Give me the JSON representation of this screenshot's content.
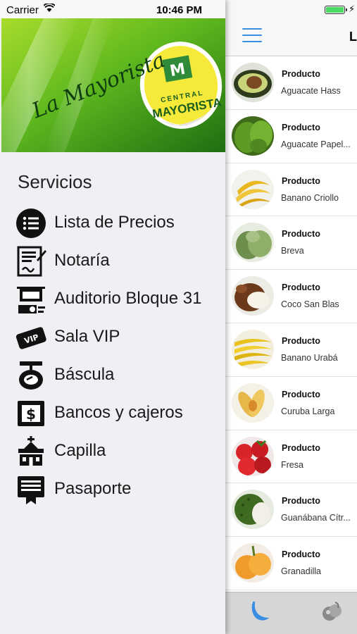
{
  "status_bar": {
    "carrier": "Carrier",
    "time": "10:46 PM"
  },
  "banner": {
    "script_text": "La Mayorista",
    "sticker_line1": "CENTRAL",
    "sticker_line2": "MAYORISTA"
  },
  "drawer": {
    "section_title": "Servicios",
    "items": [
      {
        "label": "Lista de Precios",
        "icon": "list-icon"
      },
      {
        "label": "Notaría",
        "icon": "document-sign-icon"
      },
      {
        "label": "Auditorio Bloque 31",
        "icon": "projector-icon"
      },
      {
        "label": "Sala VIP",
        "icon": "vip-ticket-icon"
      },
      {
        "label": "Báscula",
        "icon": "scale-icon"
      },
      {
        "label": "Bancos y cajeros",
        "icon": "atm-dollar-icon"
      },
      {
        "label": "Capilla",
        "icon": "chapel-icon"
      },
      {
        "label": "Pasaporte",
        "icon": "passport-icon"
      }
    ]
  },
  "main": {
    "nav_title": "L",
    "products": [
      {
        "kind": "Producto",
        "name": "Aguacate Hass"
      },
      {
        "kind": "Producto",
        "name": "Aguacate Papel..."
      },
      {
        "kind": "Producto",
        "name": "Banano Criollo"
      },
      {
        "kind": "Producto",
        "name": "Breva"
      },
      {
        "kind": "Producto",
        "name": "Coco San Blas"
      },
      {
        "kind": "Producto",
        "name": "Banano Urabá"
      },
      {
        "kind": "Producto",
        "name": "Curuba Larga"
      },
      {
        "kind": "Producto",
        "name": "Fresa"
      },
      {
        "kind": "Producto",
        "name": "Guanábana Cítr..."
      },
      {
        "kind": "Producto",
        "name": "Granadilla"
      }
    ],
    "tabs": [
      {
        "icon": "banana-icon",
        "selected": true
      },
      {
        "icon": "fruit-icon",
        "selected": false
      }
    ]
  },
  "colors": {
    "accent": "#3b8fe3",
    "banner_green": "#6fbf1f",
    "battery": "#4cd964"
  }
}
